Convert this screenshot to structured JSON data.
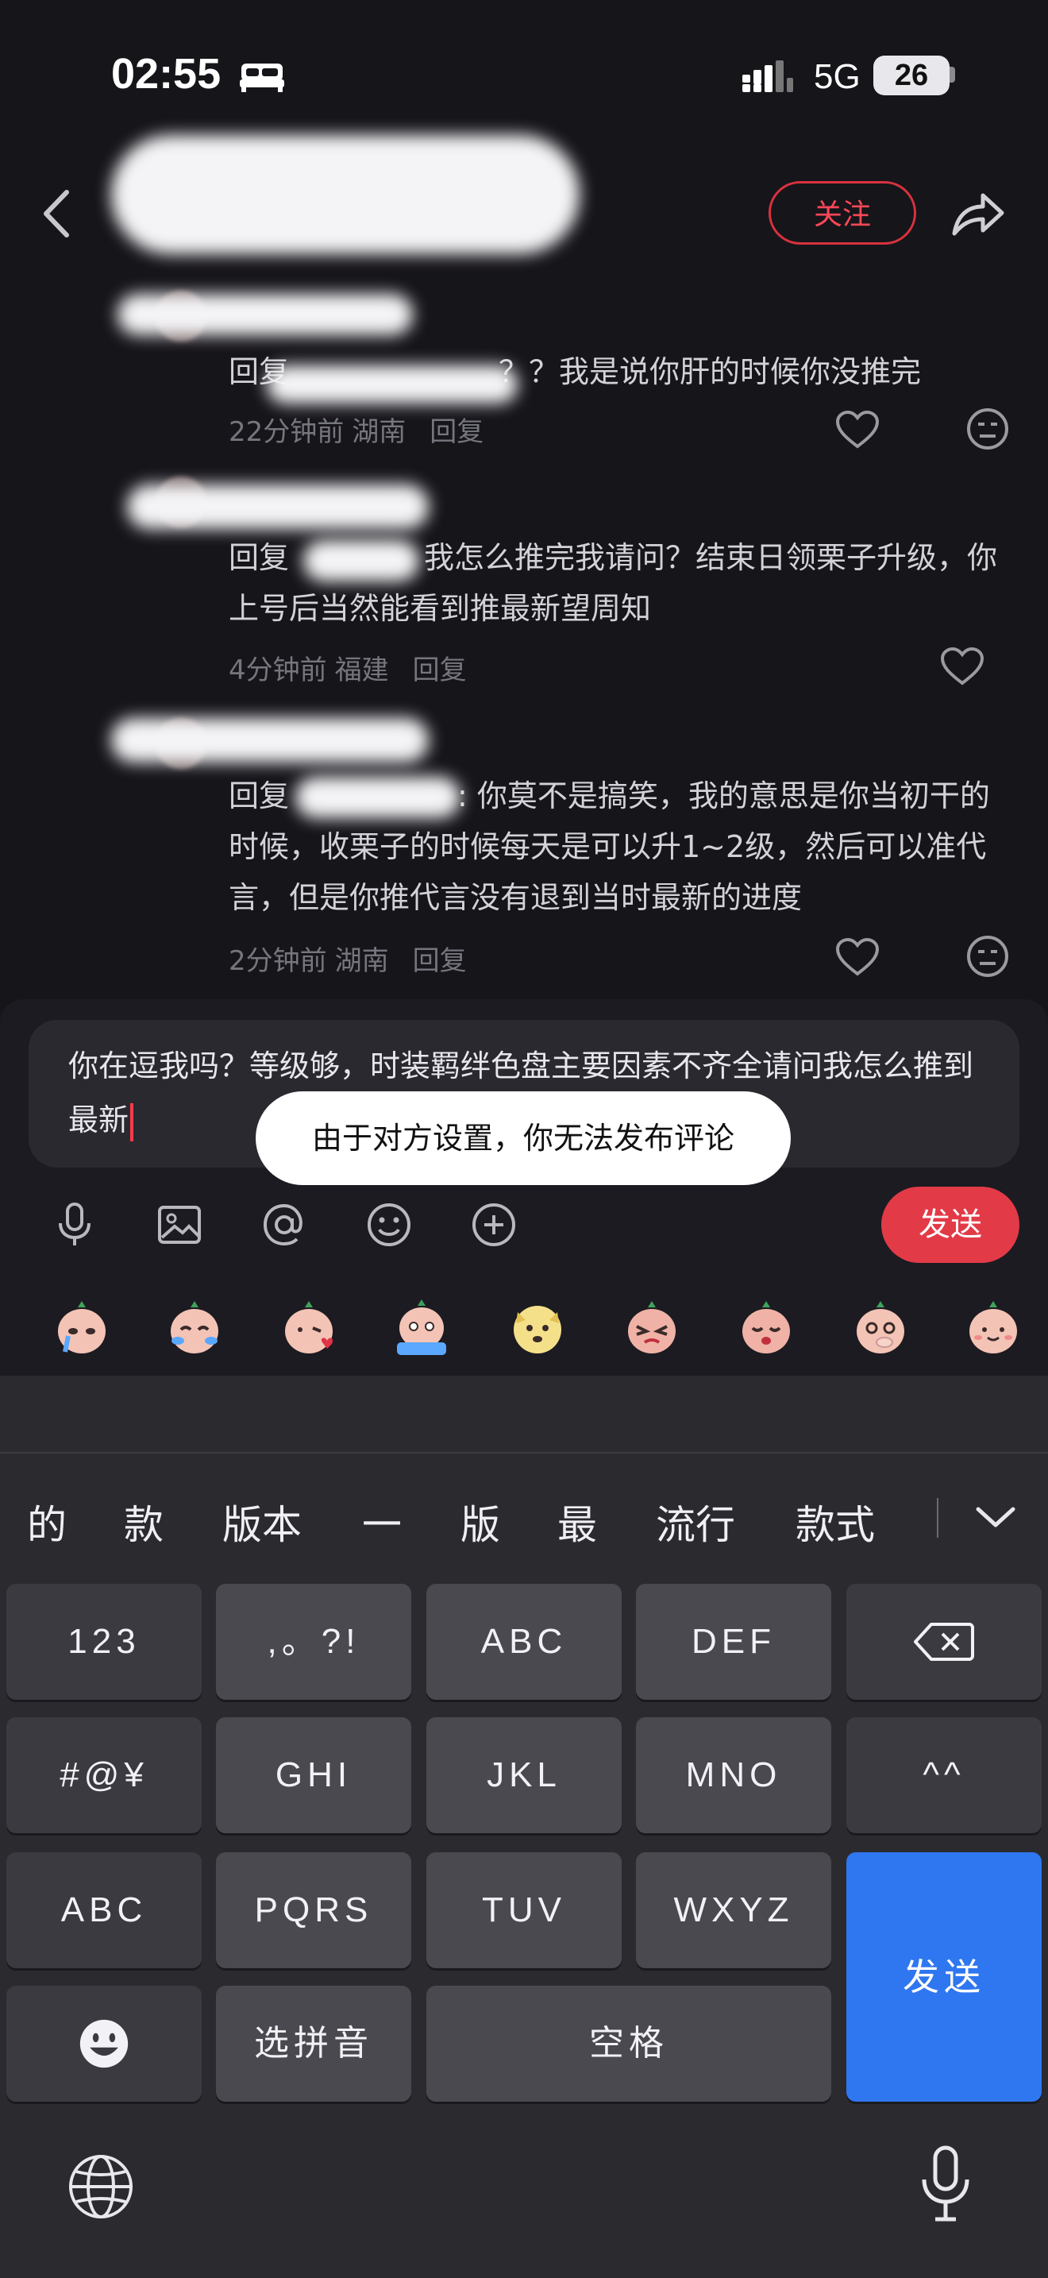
{
  "status_bar": {
    "time": "02:55",
    "network": "5G",
    "battery": "26"
  },
  "header": {
    "follow_label": "关注"
  },
  "comments": [
    {
      "text_prefix": "回复",
      "text_body": "？？我是说你肝的时候你没推完",
      "time": "22分钟前",
      "location": "湖南",
      "reply_label": "回复"
    },
    {
      "text_prefix": "回复",
      "text_body": "我怎么推完我请问？结束日领栗子升级，你上号后当然能看到推最新望周知",
      "time": "4分钟前",
      "location": "福建",
      "reply_label": "回复"
    },
    {
      "text_prefix": "回复",
      "text_body": ": 你莫不是搞笑，我的意思是你当初干的时候，收栗子的时候每天是可以升1~2级，然后可以准代言，但是你推代言没有退到当时最新的进度",
      "time": "2分钟前",
      "location": "湖南",
      "reply_label": "回复"
    }
  ],
  "composer": {
    "text": "你在逗我吗？等级够，时装羁绊色盘主要因素不齐全请问我怎么推到最新",
    "toast": "由于对方设置，你无法发布评论",
    "send_label": "发送"
  },
  "keyboard": {
    "candidates": [
      "的",
      "款",
      "版本",
      "一",
      "版",
      "最",
      "流行",
      "款式"
    ],
    "rows": [
      [
        "123",
        ",。?!",
        "ABC",
        "DEF"
      ],
      [
        "#@¥",
        "GHI",
        "JKL",
        "MNO",
        "^^"
      ],
      [
        "ABC",
        "PQRS",
        "TUV",
        "WXYZ"
      ],
      [
        "选拼音",
        "空格"
      ]
    ],
    "send_label": "发送"
  },
  "colors": {
    "accent": "#e23b47",
    "keyboard_send": "#2f77f0",
    "background": "#16151a"
  }
}
